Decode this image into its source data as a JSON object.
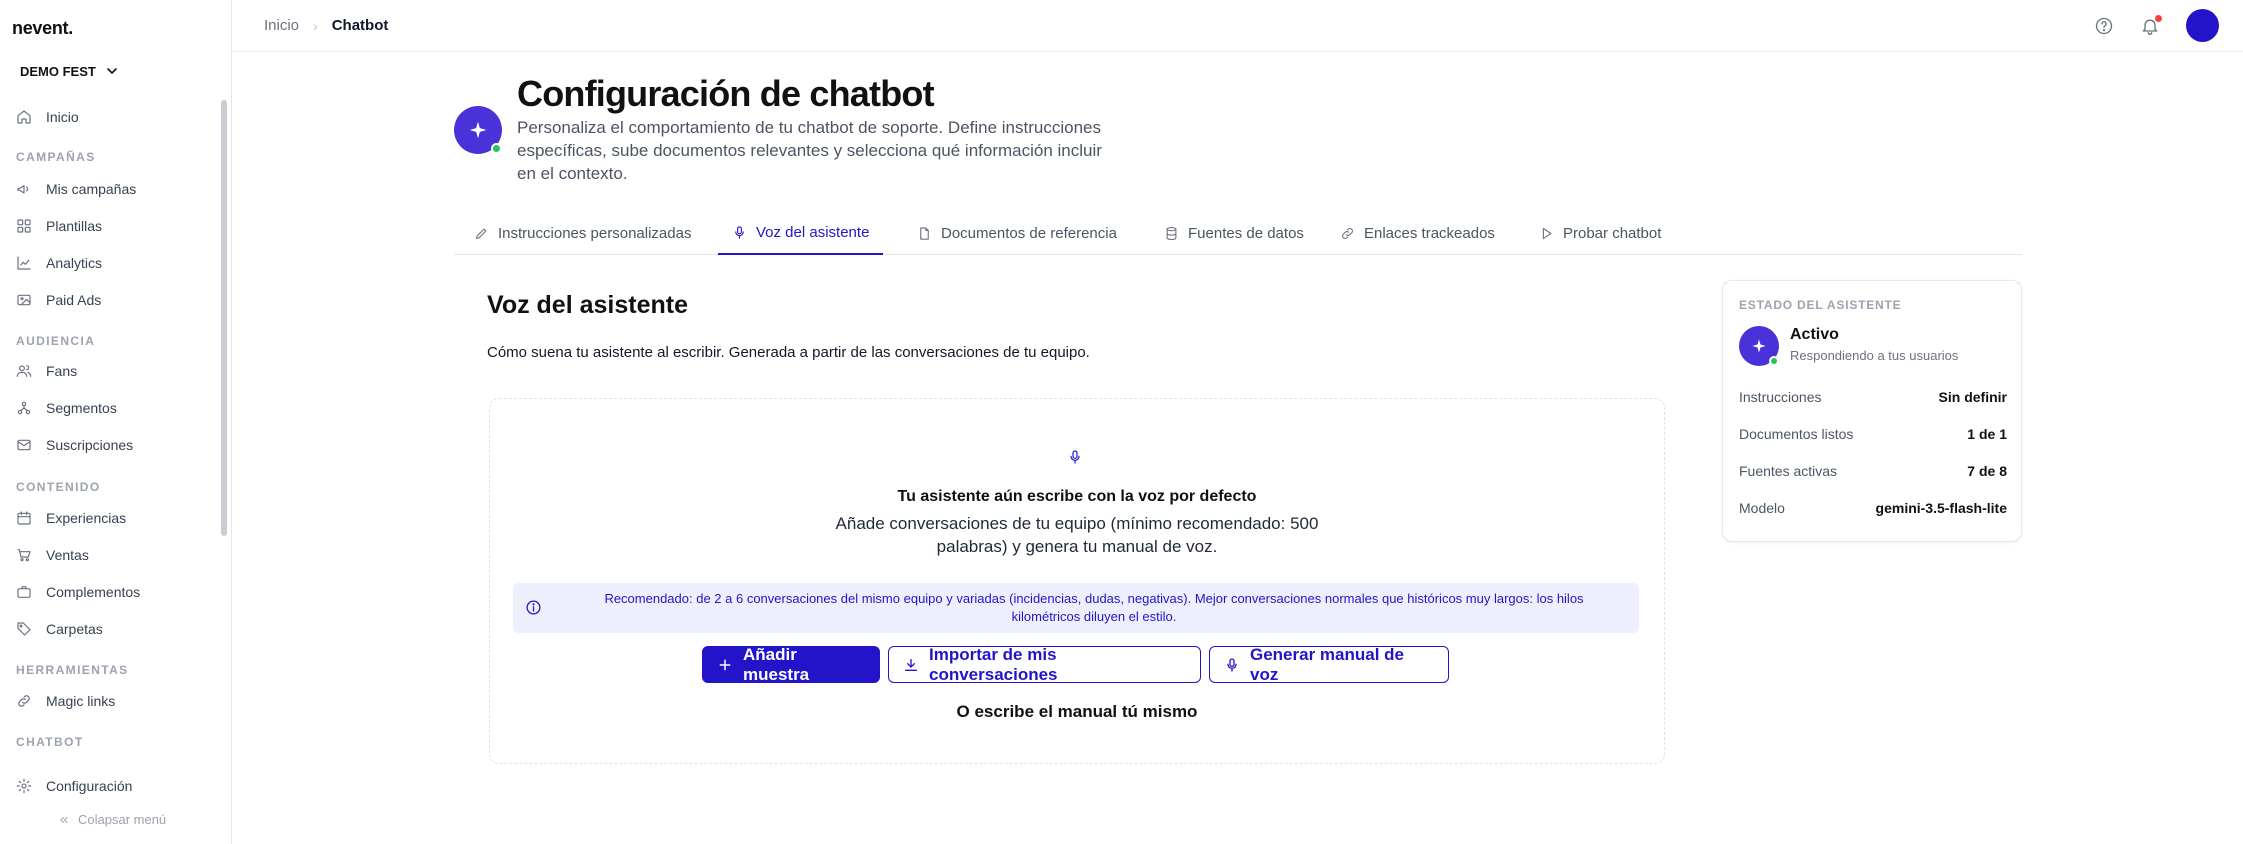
{
  "sidebar": {
    "logo": "nevent.",
    "org_name": "DEMO FEST",
    "sections": {
      "campaigns": "CAMPAÑAS",
      "audience": "AUDIENCIA",
      "content": "CONTENIDO",
      "tools": "HERRAMIENTAS",
      "chatbot": "CHATBOT"
    },
    "items": {
      "home": "Inicio",
      "campaigns": "Mis campañas",
      "templates": "Plantillas",
      "analytics": "Analytics",
      "paid_ads": "Paid Ads",
      "fans": "Fans",
      "segments": "Segmentos",
      "subscriptions": "Suscripciones",
      "experiences": "Experiencias",
      "sales": "Ventas",
      "addons": "Complementos",
      "folders": "Carpetas",
      "magic_links": "Magic links"
    },
    "config": "Configuración",
    "collapse": "Colapsar menú"
  },
  "topbar": {
    "crumb_home": "Inicio",
    "crumb_sep": "›",
    "crumb_current": "Chatbot"
  },
  "header": {
    "title": "Configuración de chatbot",
    "description": "Personaliza el comportamiento de tu chatbot de soporte. Define instrucciones específicas, sube documentos relevantes y selecciona qué información incluir en el contexto."
  },
  "tabs": {
    "instructions": "Instrucciones personalizadas",
    "voice": "Voz del asistente",
    "documents": "Documentos de referencia",
    "sources": "Fuentes de datos",
    "links": "Enlaces trackeados",
    "test": "Probar chatbot"
  },
  "main": {
    "title": "Voz del asistente",
    "description": "Cómo suena tu asistente al escribir. Generada a partir de las conversaciones de tu equipo.",
    "empty_title": "Tu asistente aún escribe con la voz por defecto",
    "empty_desc": "Añade conversaciones de tu equipo (mínimo recomendado: 500 palabras) y genera tu manual de voz.",
    "info": "Recomendado: de 2 a 6 conversaciones del mismo equipo y variadas (incidencias, dudas, negativas). Mejor conversaciones normales que históricos muy largos: los hilos kilométricos diluyen el estilo.",
    "btn_add": "Añadir muestra",
    "btn_import": "Importar de mis conversaciones",
    "btn_generate": "Generar manual de voz",
    "manual_link": "O escribe el manual tú mismo"
  },
  "status": {
    "label": "ESTADO DEL ASISTENTE",
    "state": "Activo",
    "sub": "Respondiendo a tus usuarios",
    "rows": [
      {
        "key": "Instrucciones",
        "value": "Sin definir"
      },
      {
        "key": "Documentos listos",
        "value": "1 de 1"
      },
      {
        "key": "Fuentes activas",
        "value": "7 de 8"
      },
      {
        "key": "Modelo",
        "value": "gemini-3.5-flash-lite"
      }
    ]
  },
  "colors": {
    "accent": "#2414c9",
    "assistant": "#4a32d9",
    "online": "#22c55e",
    "notification": "#ef4444"
  }
}
